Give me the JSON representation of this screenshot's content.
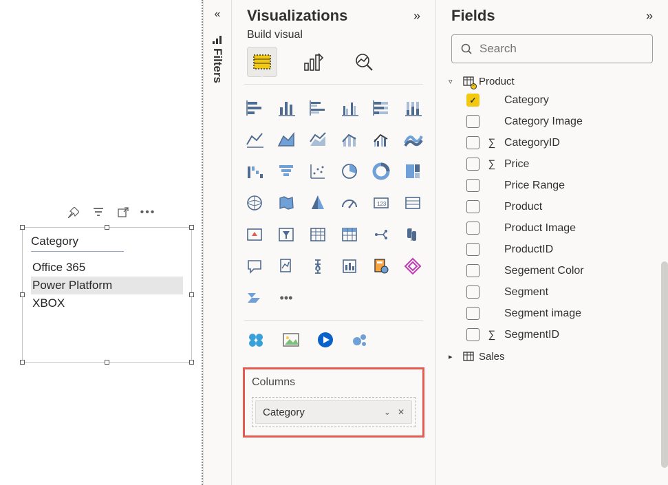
{
  "canvas": {
    "toolbar_icons": [
      "pin",
      "filter",
      "popout",
      "more"
    ],
    "visual": {
      "title": "Category",
      "rows": [
        "Office 365",
        "Power Platform",
        "XBOX"
      ],
      "selected_index": 1
    }
  },
  "filters_tab": {
    "label": "Filters"
  },
  "viz_pane": {
    "title": "Visualizations",
    "build_label": "Build visual",
    "build_tabs": [
      "table-visual",
      "format-visual",
      "analytics"
    ],
    "active_build_tab": 0,
    "viz_icons": [
      "stacked-bar",
      "stacked-column",
      "clustered-bar",
      "clustered-column",
      "100-stacked-bar",
      "100-stacked-column",
      "line",
      "area",
      "stacked-area",
      "line-stacked-column",
      "line-clustered-column",
      "ribbon",
      "waterfall",
      "funnel",
      "scatter",
      "pie",
      "donut",
      "treemap",
      "map",
      "filled-map",
      "azure-map",
      "gauge",
      "card",
      "multi-row-card",
      "kpi",
      "slicer",
      "table",
      "matrix",
      "r-visual",
      "python-visual",
      "q-and-a",
      "key-influencers",
      "decomposition",
      "smart-narrative",
      "paginated",
      "power-apps",
      "power-automate",
      "more-visuals"
    ],
    "extras": [
      "apps",
      "image",
      "play-axis",
      "bubble"
    ],
    "columns": {
      "label": "Columns",
      "field": "Category"
    }
  },
  "fields_pane": {
    "title": "Fields",
    "search_placeholder": "Search",
    "tables": [
      {
        "name": "Product",
        "expanded": true,
        "fields": [
          {
            "name": "Category",
            "checked": true,
            "agg": false
          },
          {
            "name": "Category Image",
            "checked": false,
            "agg": false
          },
          {
            "name": "CategoryID",
            "checked": false,
            "agg": true
          },
          {
            "name": "Price",
            "checked": false,
            "agg": true
          },
          {
            "name": "Price Range",
            "checked": false,
            "agg": false
          },
          {
            "name": "Product",
            "checked": false,
            "agg": false
          },
          {
            "name": "Product Image",
            "checked": false,
            "agg": false
          },
          {
            "name": "ProductID",
            "checked": false,
            "agg": false
          },
          {
            "name": "Segement Color",
            "checked": false,
            "agg": false
          },
          {
            "name": "Segment",
            "checked": false,
            "agg": false
          },
          {
            "name": "Segment image",
            "checked": false,
            "agg": false
          },
          {
            "name": "SegmentID",
            "checked": false,
            "agg": true
          }
        ]
      },
      {
        "name": "Sales",
        "expanded": false,
        "fields": []
      }
    ]
  }
}
